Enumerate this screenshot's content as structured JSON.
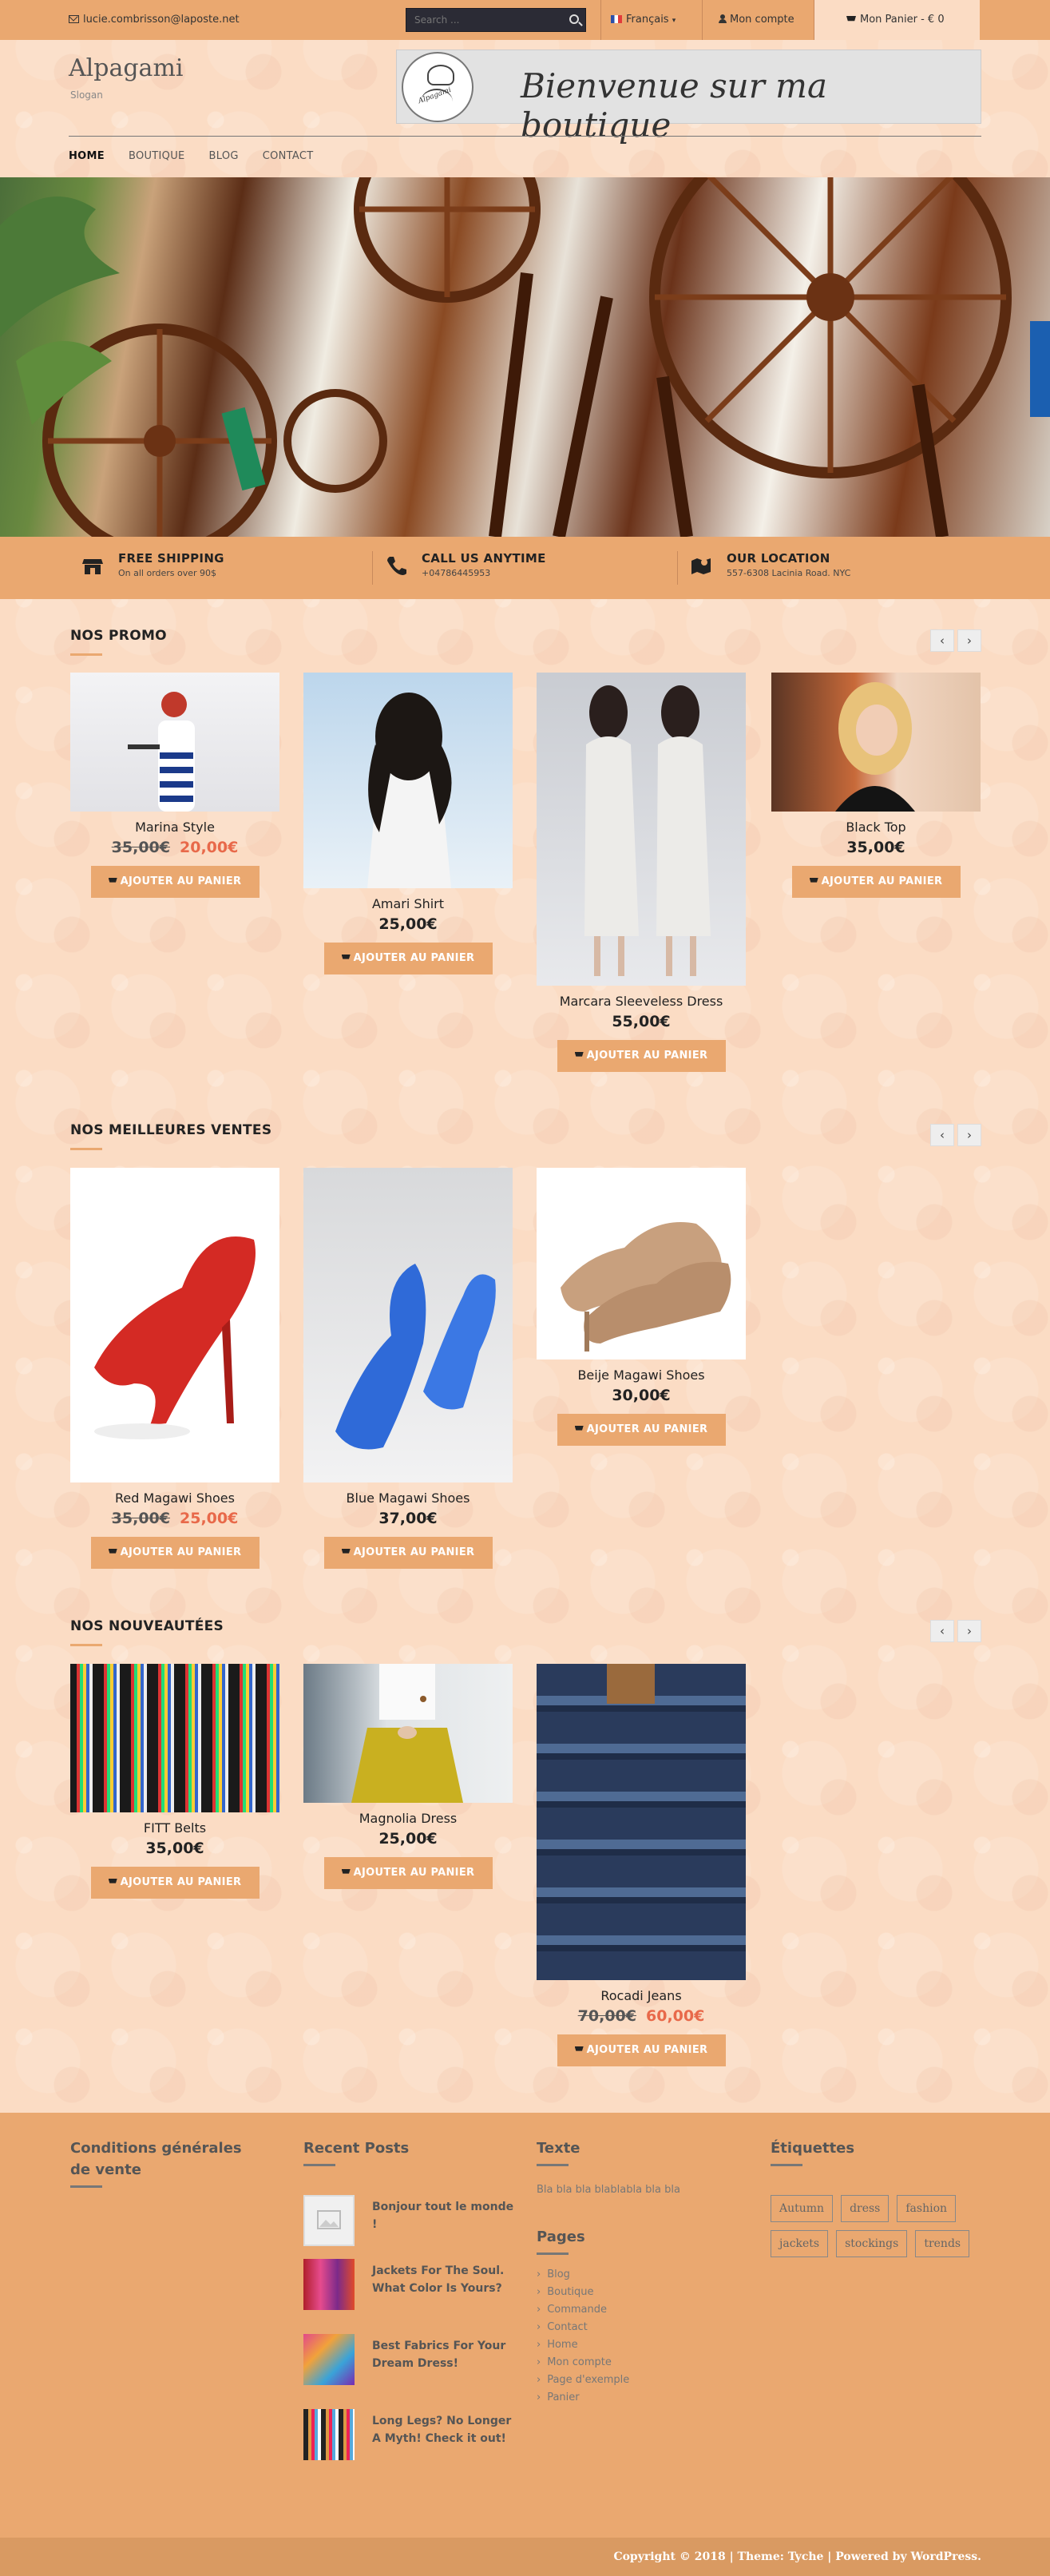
{
  "topbar": {
    "email": "lucie.combrisson@laposte.net",
    "search_placeholder": "Search ...",
    "language": "Français",
    "account": "Mon compte",
    "cart": "Mon Panier - € 0"
  },
  "header": {
    "site_title": "Alpagami",
    "slogan": "Slogan",
    "banner_text": "Bienvenue sur ma boutique",
    "banner_logo_text": "Alpagami"
  },
  "nav": [
    "HOME",
    "BOUTIQUE",
    "BLOG",
    "CONTACT"
  ],
  "features": [
    {
      "title": "FREE SHIPPING",
      "sub": "On all orders over 90$",
      "icon": "store-icon"
    },
    {
      "title": "CALL US ANYTIME",
      "sub": "+04786445953",
      "icon": "phone-icon"
    },
    {
      "title": "OUR LOCATION",
      "sub": "557-6308 Lacinia Road. NYC",
      "icon": "map-icon"
    }
  ],
  "sections": {
    "promo": {
      "title": "NOS PROMO",
      "products": [
        {
          "name": "Marina Style",
          "old_price": "35,00€",
          "price": "20,00€",
          "button": "AJOUTER AU PANIER"
        },
        {
          "name": "Amari Shirt",
          "price": "25,00€",
          "button": "AJOUTER AU PANIER"
        },
        {
          "name": "Marcara Sleeveless Dress",
          "price": "55,00€",
          "button": "AJOUTER AU PANIER"
        },
        {
          "name": "Black Top",
          "price": "35,00€",
          "button": "AJOUTER AU PANIER"
        }
      ]
    },
    "best": {
      "title": "NOS MEILLEURES VENTES",
      "products": [
        {
          "name": "Red Magawi Shoes",
          "old_price": "35,00€",
          "price": "25,00€",
          "button": "AJOUTER AU PANIER"
        },
        {
          "name": "Blue Magawi Shoes",
          "price": "37,00€",
          "button": "AJOUTER AU PANIER"
        },
        {
          "name": "Beije Magawi Shoes",
          "price": "30,00€",
          "button": "AJOUTER AU PANIER"
        }
      ]
    },
    "new": {
      "title": "NOS NOUVEAUTÉES",
      "products": [
        {
          "name": "FITT Belts",
          "price": "35,00€",
          "button": "AJOUTER AU PANIER"
        },
        {
          "name": "Magnolia Dress",
          "price": "25,00€",
          "button": "AJOUTER AU PANIER"
        },
        {
          "name": "Rocadi Jeans",
          "old_price": "70,00€",
          "price": "60,00€",
          "button": "AJOUTER AU PANIER"
        }
      ]
    }
  },
  "footer": {
    "col1_title": "Conditions générales de vente",
    "recent_title": "Recent Posts",
    "posts": [
      "Bonjour tout le monde !",
      "Jackets For The Soul. What Color Is Yours?",
      "Best Fabrics For Your Dream Dress!",
      "Long Legs? No Longer A Myth! Check it out!"
    ],
    "texte_title": "Texte",
    "texte_body": "Bla bla bla blablabla bla bla",
    "pages_title": "Pages",
    "pages": [
      "Blog",
      "Boutique",
      "Commande",
      "Contact",
      "Home",
      "Mon compte",
      "Page d'exemple",
      "Panier"
    ],
    "tags_title": "Étiquettes",
    "tags": [
      "Autumn",
      "dress",
      "fashion",
      "jackets",
      "stockings",
      "trends"
    ],
    "copyright": "Copyright © 2018   |   Theme: Tyche   |   Powered by WordPress."
  },
  "colors": {
    "accent": "#eaa870",
    "sale": "#e8694a",
    "background": "#fbdcc4"
  }
}
